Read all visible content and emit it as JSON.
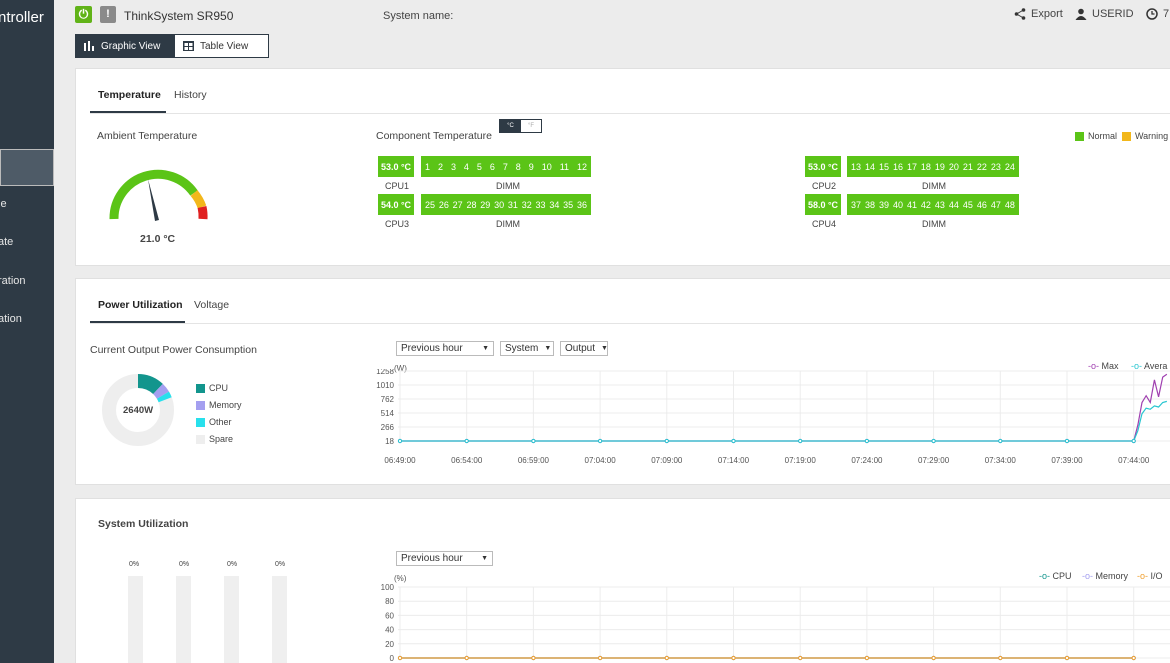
{
  "sidebar": {
    "brand": "ntroller",
    "items": [
      "le",
      "ate",
      "ration",
      "ation"
    ]
  },
  "topbar": {
    "model": "ThinkSystem SR950",
    "system_name_label": "System name:",
    "export": "Export",
    "user": "USERID",
    "time": "7"
  },
  "view_toggle": {
    "graphic": "Graphic View",
    "table": "Table View"
  },
  "temperature_card": {
    "tabs": [
      "Temperature",
      "History"
    ],
    "ambient_label": "Ambient Temperature",
    "ambient_value": "21.0 °C",
    "component_label": "Component Temperature",
    "unit_c": "°C",
    "unit_f": "°F",
    "legend": [
      {
        "label": "Normal",
        "color": "#5bc417"
      },
      {
        "label": "Warning",
        "color": "#f2b71b"
      }
    ],
    "cpus": [
      {
        "temp": "53.0 °C",
        "name": "CPU1",
        "dimm": [
          "1",
          "2",
          "3",
          "4",
          "5",
          "6",
          "7",
          "8",
          "9",
          "10",
          "11",
          "12"
        ]
      },
      {
        "temp": "54.0 °C",
        "name": "CPU3",
        "dimm": [
          "25",
          "26",
          "27",
          "28",
          "29",
          "30",
          "31",
          "32",
          "33",
          "34",
          "35",
          "36"
        ]
      },
      {
        "temp": "53.0 °C",
        "name": "CPU2",
        "dimm": [
          "13",
          "14",
          "15",
          "16",
          "17",
          "18",
          "19",
          "20",
          "21",
          "22",
          "23",
          "24"
        ]
      },
      {
        "temp": "58.0 °C",
        "name": "CPU4",
        "dimm": [
          "37",
          "38",
          "39",
          "40",
          "41",
          "42",
          "43",
          "44",
          "45",
          "46",
          "47",
          "48"
        ]
      }
    ],
    "dimm_label": "DIMM"
  },
  "power_card": {
    "tabs": [
      "Power Utilization",
      "Voltage"
    ],
    "title": "Current Output Power Consumption",
    "donut_value": "2640W",
    "donut_legend": [
      {
        "label": "CPU",
        "color": "#12958d"
      },
      {
        "label": "Memory",
        "color": "#a49ff0"
      },
      {
        "label": "Other",
        "color": "#28e0ec"
      },
      {
        "label": "Spare",
        "color": "#eeeeee"
      }
    ],
    "selects": [
      "Previous hour",
      "System",
      "Output"
    ],
    "chart_legend": [
      "Max",
      "Avera"
    ]
  },
  "system_card": {
    "title": "System Utilization",
    "bar_pcts": [
      "0%",
      "0%",
      "0%",
      "0%"
    ],
    "select": "Previous hour",
    "chart_legend": [
      "CPU",
      "Memory",
      "I/O"
    ]
  },
  "chart_data": [
    {
      "type": "line",
      "title": "",
      "ylabel": "(W)",
      "yticks": [
        1258,
        1010,
        762,
        514,
        266,
        18
      ],
      "ylim": [
        18,
        1258
      ],
      "x": [
        "06:49:00",
        "06:54:00",
        "06:59:00",
        "07:04:00",
        "07:09:00",
        "07:14:00",
        "07:19:00",
        "07:24:00",
        "07:29:00",
        "07:34:00",
        "07:39:00",
        "07:44:00"
      ],
      "series": [
        {
          "name": "Max",
          "color": "#a040b0",
          "values": [
            18,
            18,
            18,
            18,
            18,
            18,
            18,
            18,
            18,
            18,
            18,
            18,
            300,
            700,
            820,
            700,
            1100,
            800,
            1150,
            1200
          ]
        },
        {
          "name": "Avera",
          "color": "#28c6d0",
          "values": [
            18,
            18,
            18,
            18,
            18,
            18,
            18,
            18,
            18,
            18,
            18,
            18,
            200,
            500,
            600,
            580,
            640,
            620,
            700,
            720
          ]
        }
      ],
      "grid": true,
      "legend": "top-right"
    },
    {
      "type": "line",
      "title": "",
      "ylabel": "(%)",
      "yticks": [
        100,
        80,
        60,
        40,
        20,
        0
      ],
      "ylim": [
        0,
        100
      ],
      "series": [
        {
          "name": "CPU",
          "color": "#12958d",
          "values": [
            0,
            0,
            0,
            0,
            0,
            0,
            0,
            0,
            0,
            0,
            0,
            0
          ]
        },
        {
          "name": "Memory",
          "color": "#a49ff0",
          "values": [
            0,
            0,
            0,
            0,
            0,
            0,
            0,
            0,
            0,
            0,
            0,
            0
          ]
        },
        {
          "name": "I/O",
          "color": "#f0a030",
          "values": [
            0,
            0,
            0,
            0,
            0,
            0,
            0,
            0,
            0,
            0,
            0,
            0
          ]
        }
      ],
      "grid": true,
      "legend": "top-right"
    }
  ]
}
